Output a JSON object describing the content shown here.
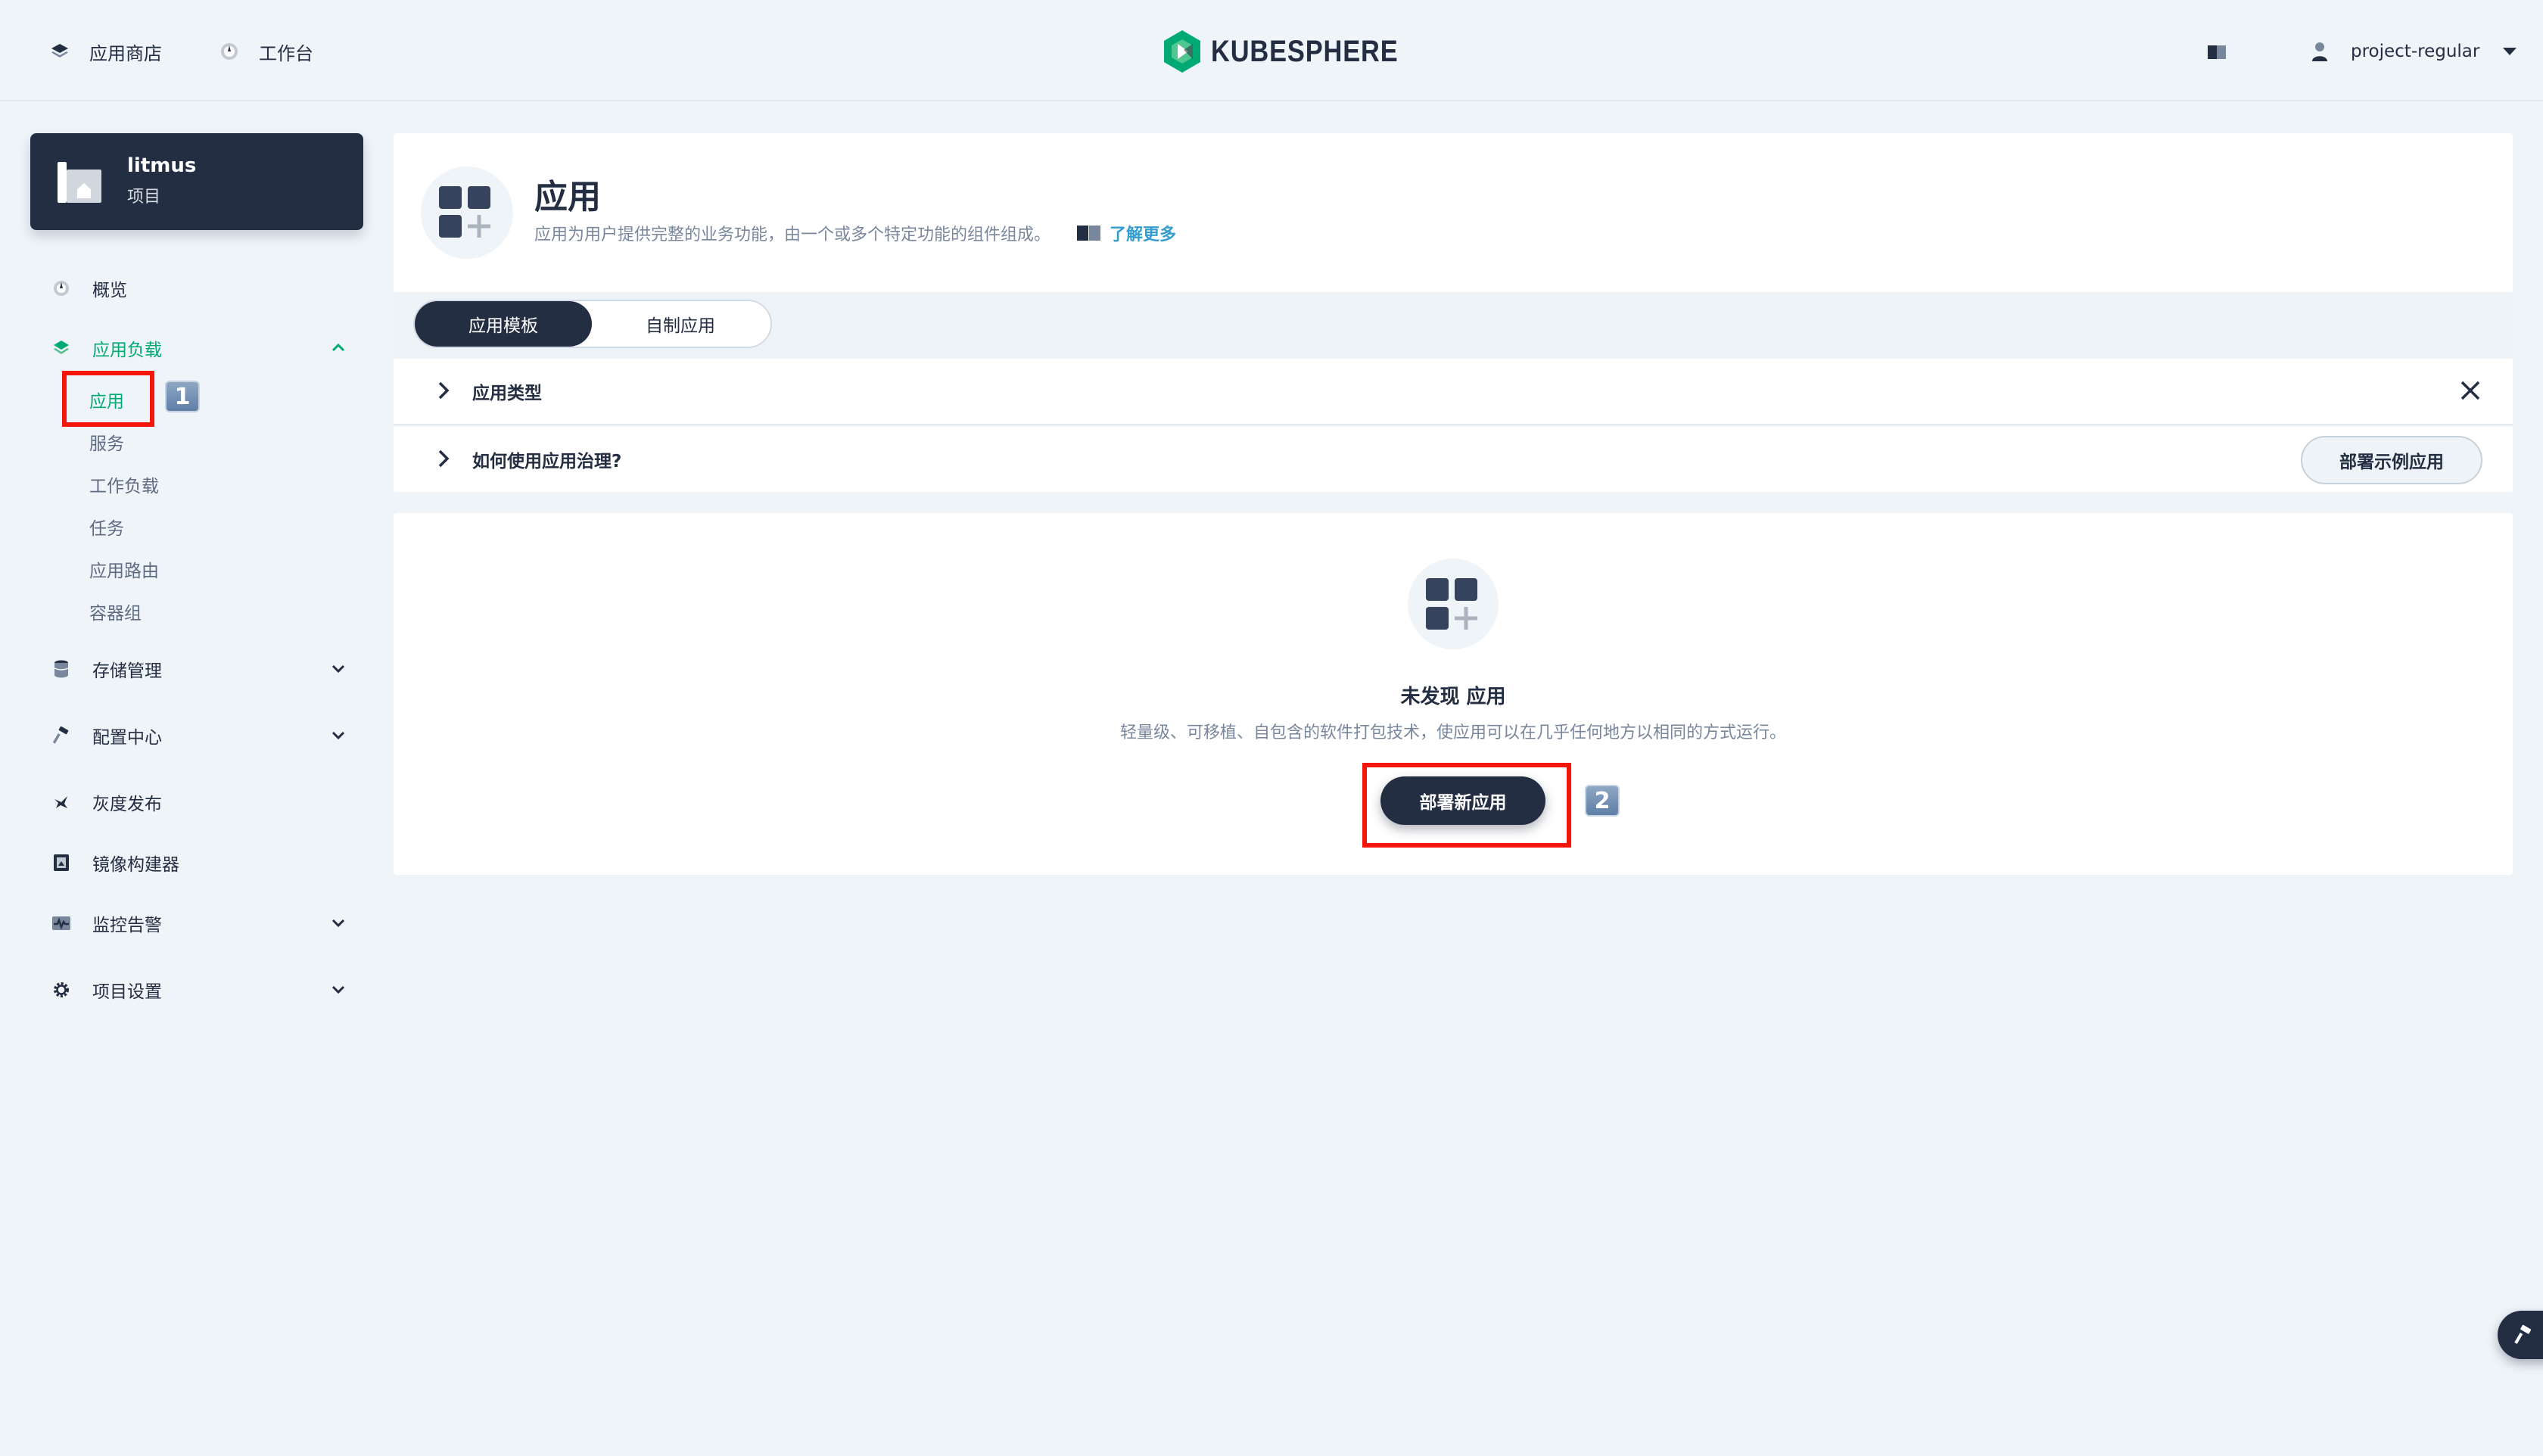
{
  "topnav": {
    "app_store_label": "应用商店",
    "workbench_label": "工作台",
    "logo_text": "KUBESPHERE",
    "username": "project-regular"
  },
  "project": {
    "name": "litmus",
    "type": "项目"
  },
  "sidebar": {
    "overview": "概览",
    "app_workloads": "应用负载",
    "sub_items": [
      "应用",
      "服务",
      "工作负载",
      "任务",
      "应用路由",
      "容器组"
    ],
    "storage": "存储管理",
    "config": "配置中心",
    "grayscale": "灰度发布",
    "image_builder": "镜像构建器",
    "monitoring": "监控告警",
    "project_settings": "项目设置"
  },
  "annotations": {
    "step1": "1",
    "step2": "2",
    "highlight_color": "#f4150b"
  },
  "header": {
    "title": "应用",
    "description": "应用为用户提供完整的业务功能，由一个或多个特定功能的组件组成。",
    "learn_more": "了解更多"
  },
  "tabs": [
    "应用模板",
    "自制应用"
  ],
  "info_rows": {
    "app_type": "应用类型",
    "how_to": "如何使用应用治理?",
    "deploy_sample": "部署示例应用"
  },
  "empty": {
    "title": "未发现 应用",
    "description": "轻量级、可移植、自包含的软件打包技术，使应用可以在几乎任何地方以相同的方式运行。",
    "deploy_button": "部署新应用"
  },
  "colors": {
    "accent_green": "#00aa72",
    "dark": "#242e42",
    "background": "#eff4f9"
  }
}
